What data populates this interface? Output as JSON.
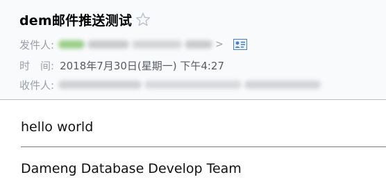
{
  "email": {
    "subject": "dem邮件推送测试",
    "from_label": "发件人:",
    "from_suffix": ">",
    "time_label": "时　间:",
    "time_value": "2018年7月30日(星期一) 下午4:27",
    "to_label": "收件人:"
  },
  "body": {
    "line1": "hello world",
    "signature": "Dameng Database Develop Team"
  },
  "icons": {
    "star": "star-outline-icon",
    "contact": "contact-card-icon"
  },
  "colors": {
    "header_bg": "#f9fafc",
    "label": "#9aa0a8",
    "star": "#b8c2cc",
    "contact_icon": "#4a7fc1"
  }
}
